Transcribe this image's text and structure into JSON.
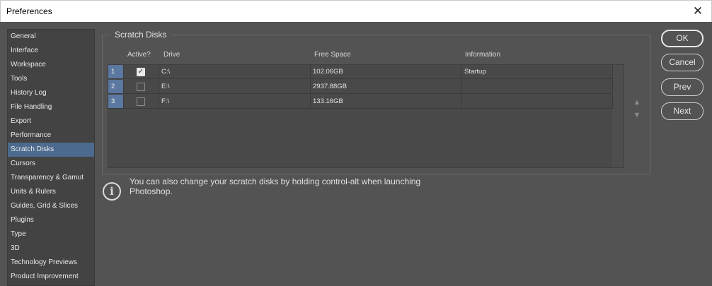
{
  "window": {
    "title": "Preferences",
    "close_glyph": "✕"
  },
  "sidebar": {
    "items": [
      {
        "label": "General"
      },
      {
        "label": "Interface"
      },
      {
        "label": "Workspace"
      },
      {
        "label": "Tools"
      },
      {
        "label": "History Log"
      },
      {
        "label": "File Handling"
      },
      {
        "label": "Export"
      },
      {
        "label": "Performance"
      },
      {
        "label": "Scratch Disks",
        "active": true
      },
      {
        "label": "Cursors"
      },
      {
        "label": "Transparency & Gamut"
      },
      {
        "label": "Units & Rulers"
      },
      {
        "label": "Guides, Grid & Slices"
      },
      {
        "label": "Plugins"
      },
      {
        "label": "Type"
      },
      {
        "label": "3D"
      },
      {
        "label": "Technology Previews"
      },
      {
        "label": "Product Improvement"
      }
    ]
  },
  "scratch_disks": {
    "group_title": "Scratch Disks",
    "columns": {
      "active": "Active?",
      "drive": "Drive",
      "free_space": "Free Space",
      "information": "Information"
    },
    "rows": [
      {
        "num": "1",
        "active": true,
        "drive": "C:\\",
        "free_space": "102.06GB",
        "information": "Startup"
      },
      {
        "num": "2",
        "active": false,
        "drive": "E:\\",
        "free_space": "2937.88GB",
        "information": ""
      },
      {
        "num": "3",
        "active": false,
        "drive": "F:\\",
        "free_space": "133.16GB",
        "information": ""
      }
    ],
    "move_up_icon": "triangle-up",
    "move_down_icon": "triangle-down"
  },
  "info": {
    "icon": "info-icon",
    "text": "You can also change your scratch disks by holding control-alt when launching Photoshop."
  },
  "buttons": {
    "ok": "OK",
    "cancel": "Cancel",
    "prev": "Prev",
    "next": "Next"
  },
  "colors": {
    "background": "#535353",
    "sidebar_active": "#4b6a8d",
    "row_number": "#5a78a0"
  }
}
